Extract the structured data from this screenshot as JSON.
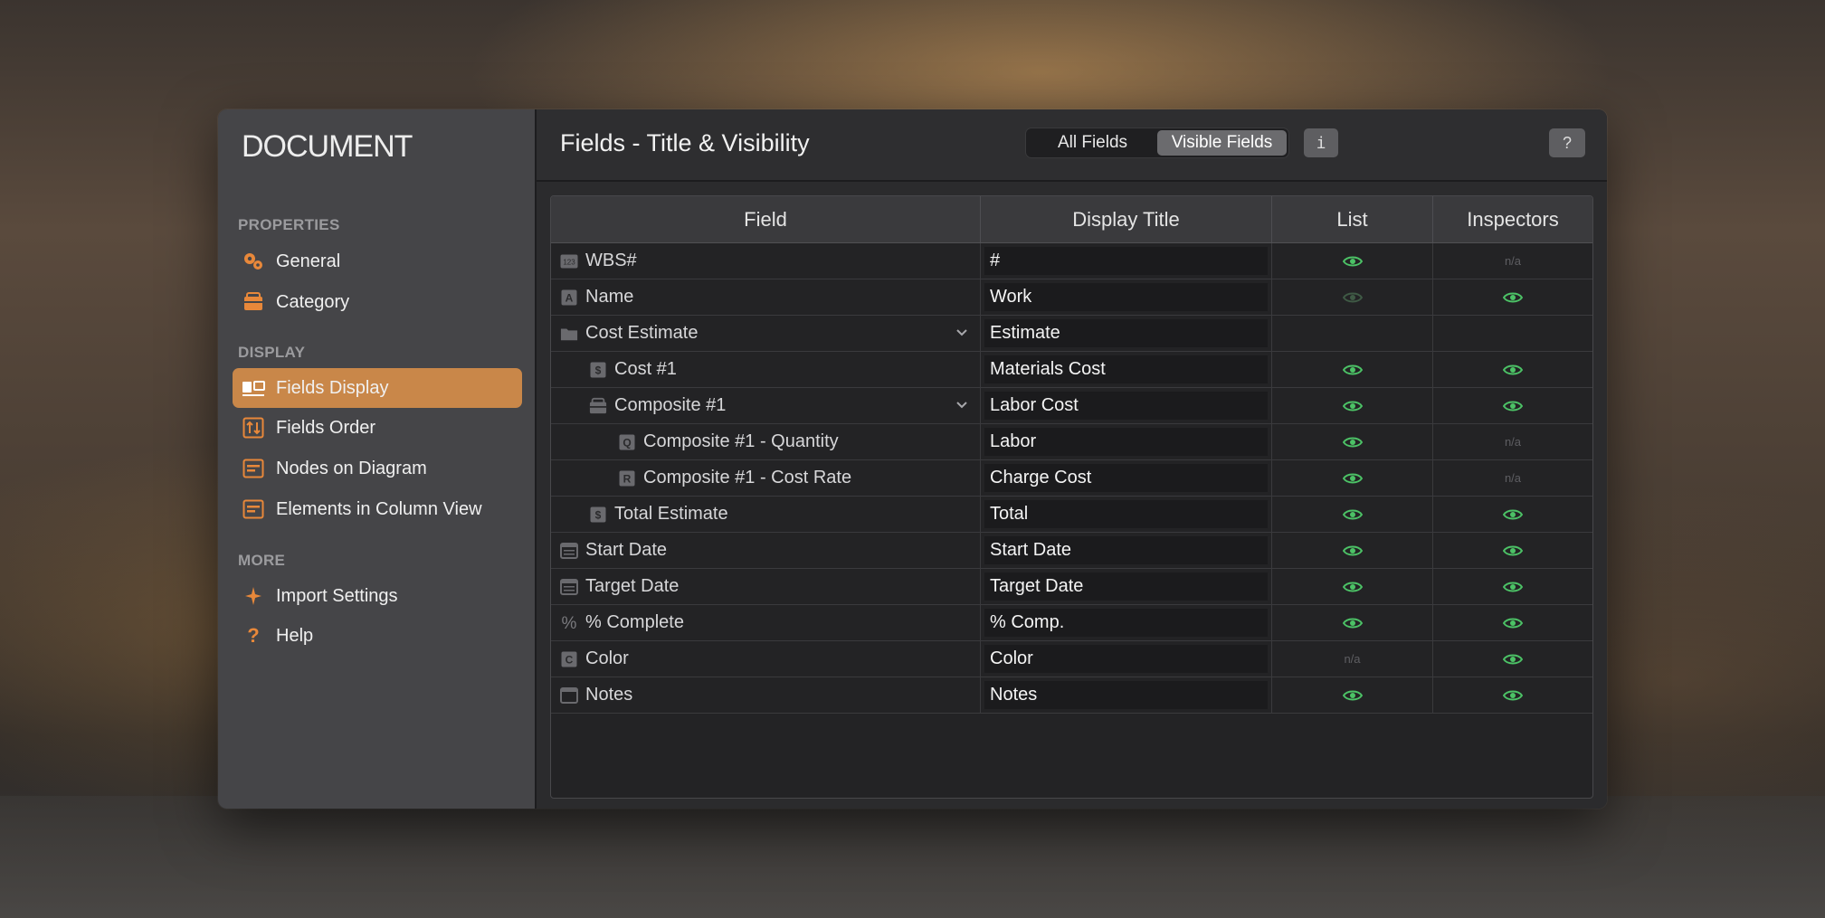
{
  "sidebar": {
    "title": "DOCUMENT",
    "sections": {
      "properties": "PROPERTIES",
      "display": "DISPLAY",
      "more": "MORE"
    },
    "items": [
      {
        "label": "General",
        "icon": "gears-icon",
        "active": false
      },
      {
        "label": "Category",
        "icon": "category-box-icon",
        "active": false
      },
      {
        "label": "Fields Display",
        "icon": "fields-display-icon",
        "active": true
      },
      {
        "label": "Fields Order",
        "icon": "fields-order-icon",
        "active": false
      },
      {
        "label": "Nodes on Diagram",
        "icon": "nodes-diagram-icon",
        "active": false
      },
      {
        "label": "Elements in Column View",
        "icon": "column-view-icon",
        "active": false
      },
      {
        "label": "Import Settings",
        "icon": "sparkle-icon",
        "active": false
      },
      {
        "label": "Help",
        "icon": "question-icon",
        "active": false
      }
    ]
  },
  "header": {
    "title": "Fields - Title & Visibility",
    "segments": [
      "All Fields",
      "Visible Fields"
    ],
    "selected_segment": "Visible Fields",
    "info_label": "i",
    "help_label": "?"
  },
  "table": {
    "columns": [
      "Field",
      "Display Title",
      "List",
      "Inspectors"
    ],
    "na_text": "n/a",
    "rows": [
      {
        "field": "WBS#",
        "icon": "number-icon",
        "indent": 0,
        "title": "#",
        "list": "on",
        "inspectors": "na"
      },
      {
        "field": "Name",
        "icon": "text-a-icon",
        "indent": 0,
        "title": "Work",
        "list": "dim",
        "inspectors": "on"
      },
      {
        "field": "Cost Estimate",
        "icon": "folder-icon",
        "indent": 0,
        "title": "Estimate",
        "list": "none",
        "inspectors": "none",
        "expandable": true
      },
      {
        "field": "Cost #1",
        "icon": "dollar-icon",
        "indent": 1,
        "title": "Materials Cost",
        "list": "on",
        "inspectors": "on"
      },
      {
        "field": "Composite #1",
        "icon": "composite-icon",
        "indent": 1,
        "title": "Labor Cost",
        "list": "on",
        "inspectors": "on",
        "expandable": true
      },
      {
        "field": "Composite #1 - Quantity",
        "icon": "quantity-q-icon",
        "indent": 2,
        "title": "Labor",
        "list": "on",
        "inspectors": "na"
      },
      {
        "field": "Composite #1 - Cost Rate",
        "icon": "rate-r-icon",
        "indent": 2,
        "title": "Charge Cost",
        "list": "on",
        "inspectors": "na"
      },
      {
        "field": "Total Estimate",
        "icon": "dollar-icon",
        "indent": 1,
        "title": "Total",
        "list": "on",
        "inspectors": "on"
      },
      {
        "field": "Start Date",
        "icon": "calendar-icon",
        "indent": 0,
        "title": "Start Date",
        "list": "on",
        "inspectors": "on"
      },
      {
        "field": "Target Date",
        "icon": "calendar-icon",
        "indent": 0,
        "title": "Target Date",
        "list": "on",
        "inspectors": "on"
      },
      {
        "field": "% Complete",
        "icon": "percent-icon",
        "indent": 0,
        "title": "% Comp.",
        "list": "on",
        "inspectors": "on"
      },
      {
        "field": "Color",
        "icon": "color-c-icon",
        "indent": 0,
        "title": "Color",
        "list": "na",
        "inspectors": "on"
      },
      {
        "field": "Notes",
        "icon": "notes-icon",
        "indent": 0,
        "title": "Notes",
        "list": "on",
        "inspectors": "on"
      }
    ]
  },
  "colors": {
    "accent": "#c98749",
    "eye_on": "#4cc266",
    "eye_dim": "#3f5a45"
  }
}
